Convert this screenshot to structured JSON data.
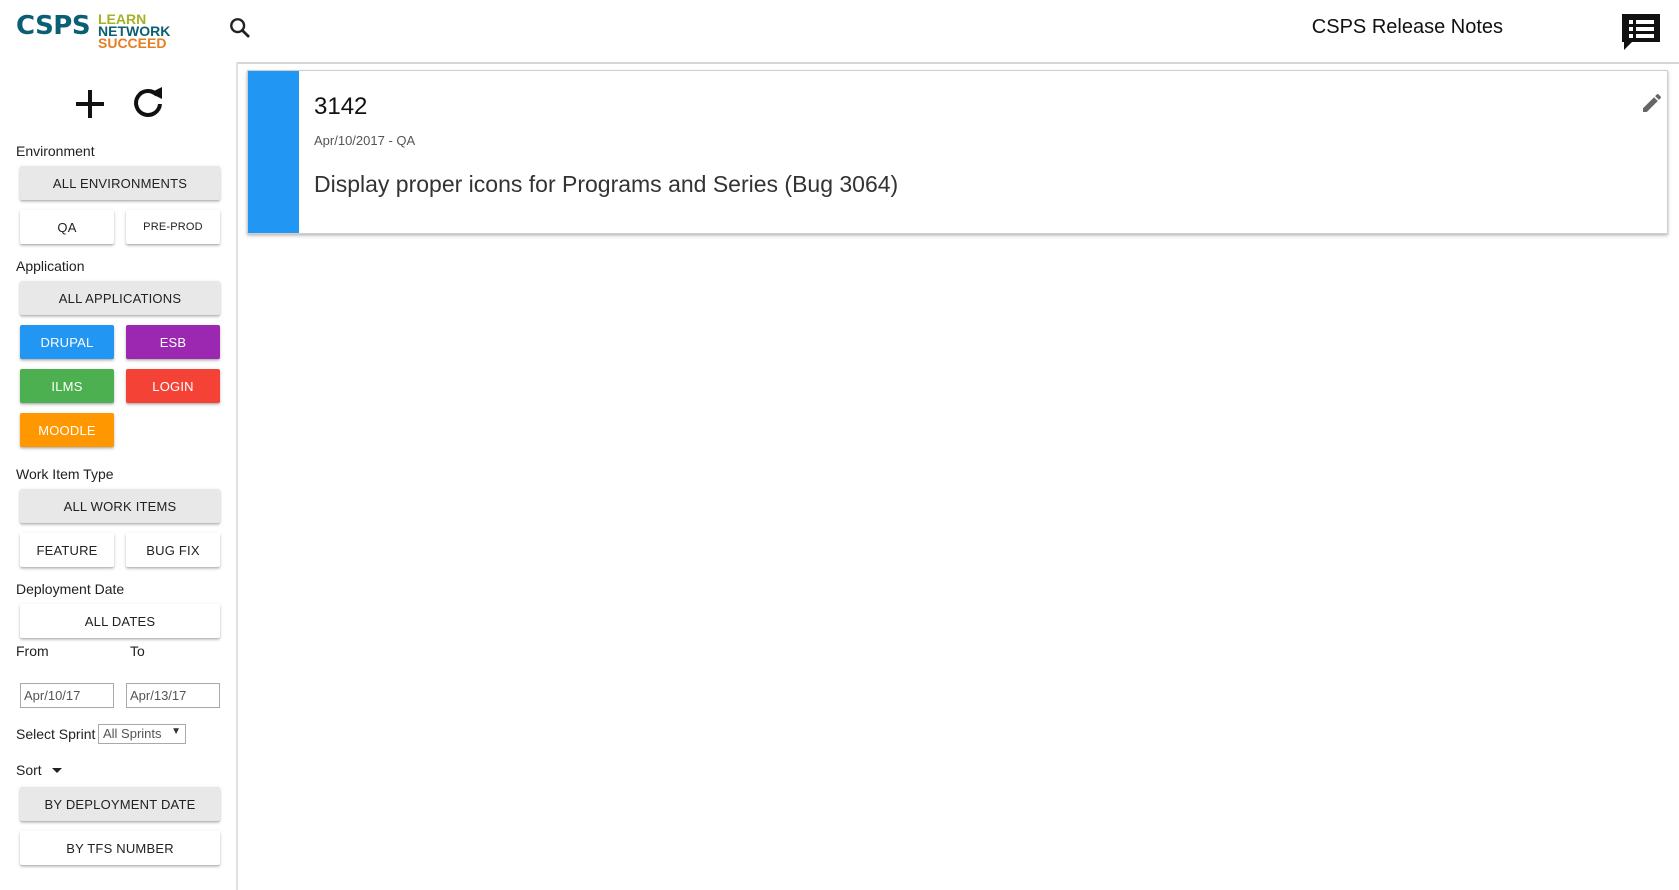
{
  "header": {
    "logo": {
      "main": "CSPS",
      "line1": "LEARN",
      "line2": "NETWORK",
      "line3": "SUCCEED"
    },
    "search_icon": "search-icon",
    "app_title": "CSPS Release Notes",
    "notes_icon": "release-notes-icon"
  },
  "sidebar": {
    "add_icon": "add-icon",
    "refresh_icon": "refresh-icon",
    "environment": {
      "label": "Environment",
      "all": "ALL ENVIRONMENTS",
      "options": [
        "QA",
        "PRE-PROD"
      ]
    },
    "application": {
      "label": "Application",
      "all": "ALL APPLICATIONS",
      "options": [
        {
          "label": "DRUPAL",
          "color": "#2196f3"
        },
        {
          "label": "ESB",
          "color": "#9c27b0"
        },
        {
          "label": "ILMS",
          "color": "#4caf50"
        },
        {
          "label": "LOGIN",
          "color": "#f44336"
        },
        {
          "label": "MOODLE",
          "color": "#ff9800"
        }
      ]
    },
    "work_item_type": {
      "label": "Work Item Type",
      "all": "ALL WORK ITEMS",
      "options": [
        "FEATURE",
        "BUG FIX"
      ]
    },
    "deployment_date": {
      "label": "Deployment Date",
      "all": "ALL DATES",
      "from_label": "From",
      "to_label": "To",
      "from_value": "Apr/10/17",
      "to_value": "Apr/13/17"
    },
    "sprint": {
      "label": "Select Sprint",
      "selected": "All Sprints"
    },
    "sort": {
      "label": "Sort",
      "options": [
        "BY DEPLOYMENT DATE",
        "BY TFS NUMBER"
      ]
    }
  },
  "cards": [
    {
      "number": "3142",
      "meta": "Apr/10/2017 - QA",
      "description": "Display proper icons for Programs and Series (Bug 3064)",
      "accent_color": "#2196f3",
      "edit_icon": "edit-icon"
    }
  ]
}
